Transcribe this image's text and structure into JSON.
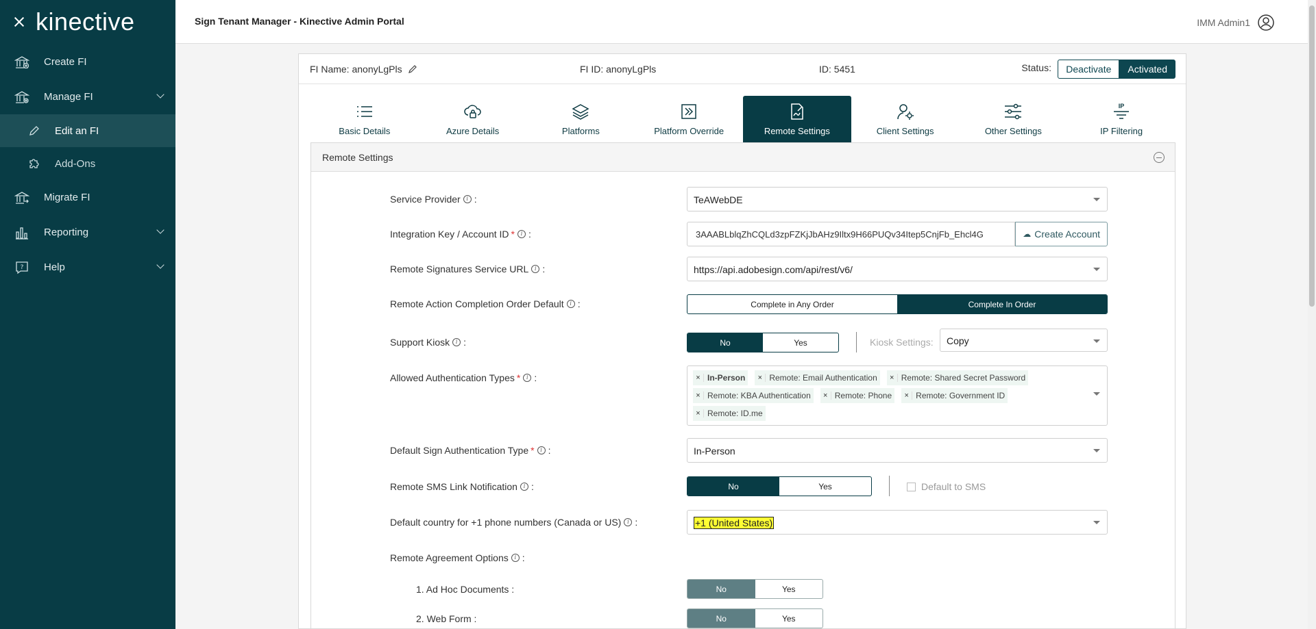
{
  "sidebar": {
    "logo": "kinective",
    "items": [
      {
        "label": "Create FI"
      },
      {
        "label": "Manage FI"
      },
      {
        "label": "Edit an FI"
      },
      {
        "label": "Add-Ons"
      },
      {
        "label": "Migrate FI"
      },
      {
        "label": "Reporting"
      },
      {
        "label": "Help"
      }
    ]
  },
  "header": {
    "title": "Sign Tenant Manager - Kinective Admin Portal",
    "user": "IMM Admin1"
  },
  "fi": {
    "name_label": "FI Name: anonyLgPls",
    "fi_id_label": "FI ID: anonyLgPls",
    "id_label": "ID: 5451",
    "status_label": "Status:",
    "deactivate": "Deactivate",
    "activated": "Activated"
  },
  "tabs": [
    {
      "label": "Basic Details"
    },
    {
      "label": "Azure Details"
    },
    {
      "label": "Platforms"
    },
    {
      "label": "Platform Override"
    },
    {
      "label": "Remote Settings"
    },
    {
      "label": "Client Settings"
    },
    {
      "label": "Other Settings"
    },
    {
      "label": "IP Filtering"
    }
  ],
  "section": {
    "title": "Remote Settings",
    "service_provider": {
      "label": "Service Provider",
      "value": "TeAWebDE"
    },
    "integration_key": {
      "label": "Integration Key / Account ID",
      "value": "3AAABLblqZhCQLd3zpFZKjJbAHz9Iltx9H66PUQv34Itep5CnjFb_Ehcl4G",
      "button": "Create Account"
    },
    "service_url": {
      "label": "Remote Signatures Service URL",
      "value": "https://api.adobesign.com/api/rest/v6/"
    },
    "completion_order": {
      "label": "Remote Action Completion Order Default",
      "opt1": "Complete in Any Order",
      "opt2": "Complete In Order"
    },
    "support_kiosk": {
      "label": "Support Kiosk",
      "no": "No",
      "yes": "Yes",
      "kiosk_label": "Kiosk Settings:",
      "kiosk_value": "Copy"
    },
    "auth_types": {
      "label": "Allowed Authentication Types",
      "tags": [
        "In-Person",
        "Remote: Email Authentication",
        "Remote: Shared Secret Password",
        "Remote: KBA Authentication",
        "Remote: Phone",
        "Remote: Government ID",
        "Remote: ID.me"
      ]
    },
    "default_auth": {
      "label": "Default Sign Authentication Type",
      "value": "In-Person"
    },
    "sms_link": {
      "label": "Remote SMS Link Notification",
      "no": "No",
      "yes": "Yes",
      "default_sms": "Default to SMS"
    },
    "default_country": {
      "label": "Default country for +1 phone numbers (Canada or US)",
      "value": "+1 (United States)"
    },
    "agreement_options": {
      "label": "Remote Agreement Options"
    },
    "ad_hoc": {
      "label": "1. Ad Hoc Documents :",
      "no": "No",
      "yes": "Yes"
    },
    "web_form": {
      "label": "2. Web Form :",
      "no": "No",
      "yes": "Yes"
    }
  }
}
